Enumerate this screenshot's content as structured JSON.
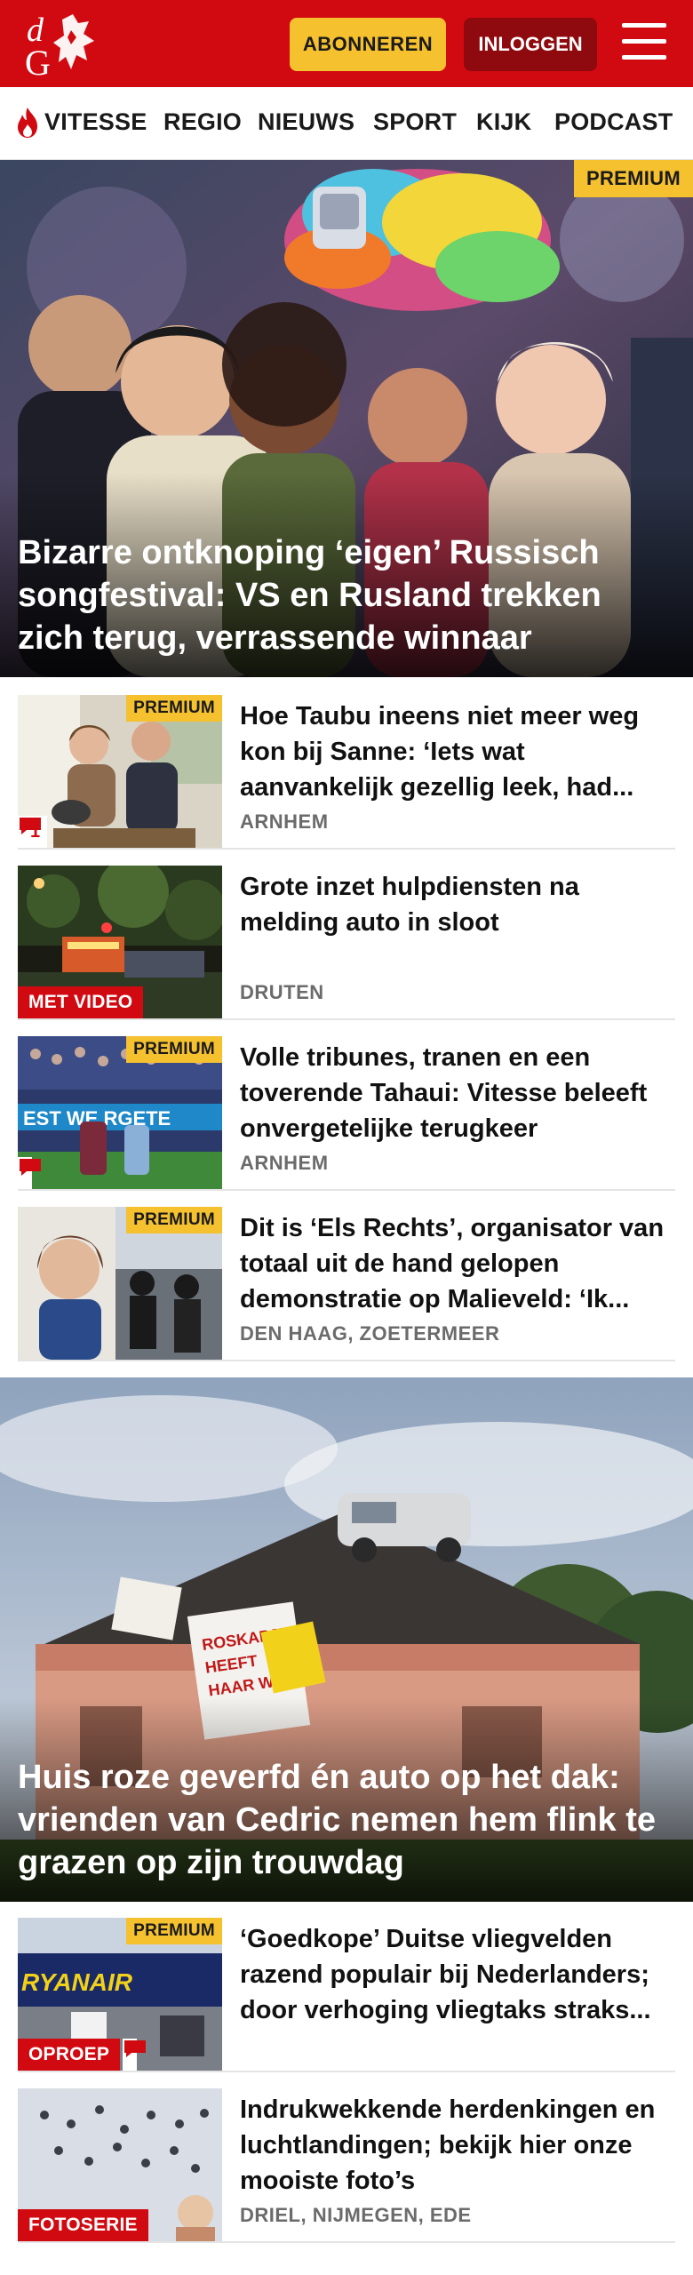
{
  "brand": {
    "logo_text": "dG",
    "primary_color": "#d10a11",
    "accent_color": "#f5c12f"
  },
  "header": {
    "subscribe_label": "ABONNEREN",
    "login_label": "INLOGGEN",
    "menu_icon": "hamburger-menu-icon"
  },
  "nav": {
    "items": [
      {
        "label": "VITESSE",
        "icon": "flame-icon"
      },
      {
        "label": "REGIO"
      },
      {
        "label": "NIEUWS"
      },
      {
        "label": "SPORT"
      },
      {
        "label": "KIJK"
      },
      {
        "label": "PODCAST"
      }
    ]
  },
  "hero1": {
    "badge": "PREMIUM",
    "title": "Bizarre ontknoping ‘eigen’ Russisch songfestival: VS en Rusland trekken zich terug, verrassende winnaar"
  },
  "articles1": [
    {
      "title": "Hoe Taubu ineens niet meer weg kon bij Sanne: ‘Iets wat aanvankelijk gezellig leek, had...",
      "location": "ARNHEM",
      "premium": "PREMIUM",
      "comments": "1"
    },
    {
      "title": "Grote inzet hulpdiensten na melding auto in sloot",
      "location": "DRUTEN",
      "label": "MET VIDEO"
    },
    {
      "title": "Volle tribunes, tranen en een toverende Tahaui: Vitesse beleeft onvergetelijke terugkeer",
      "location": "ARNHEM",
      "premium": "PREMIUM"
    },
    {
      "title": "Dit is ‘Els Rechts’, organisator van totaal uit de hand gelopen demonstratie op Malieveld: ‘Ik...",
      "location": "DEN HAAG, ZOETERMEER",
      "premium": "PREMIUM"
    }
  ],
  "hero2": {
    "title": "Huis roze geverfd én auto op het dak: vrienden van Cedric nemen hem flink te grazen op zijn trouwdag"
  },
  "articles2": [
    {
      "title": "‘Goedkope’ Duitse vliegvelden razend populair bij Nederlanders; door verhoging vliegtaks straks...",
      "premium": "PREMIUM",
      "label": "OPROEP"
    },
    {
      "title": "Indrukwekkende herdenkingen en luchtlandingen; bekijk hier onze mooiste foto’s",
      "location": "DRIEL, NIJMEGEN, EDE",
      "label": "FOTOSERIE"
    }
  ]
}
